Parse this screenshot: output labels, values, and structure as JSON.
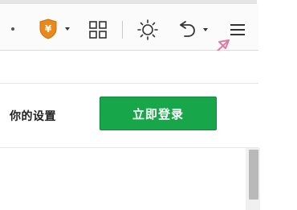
{
  "toolbar": {
    "icons": [
      "dot-icon",
      "shield-icon",
      "grid-icon",
      "sun-icon",
      "undo-icon",
      "menu-icon"
    ],
    "shield_symbol": "¥",
    "shield_color": "#e8891b",
    "arrow_color": "#e07aa5"
  },
  "panel": {
    "settings_text": "你的设置",
    "login_button_label": "立即登录",
    "login_button_color": "#18a64a"
  }
}
